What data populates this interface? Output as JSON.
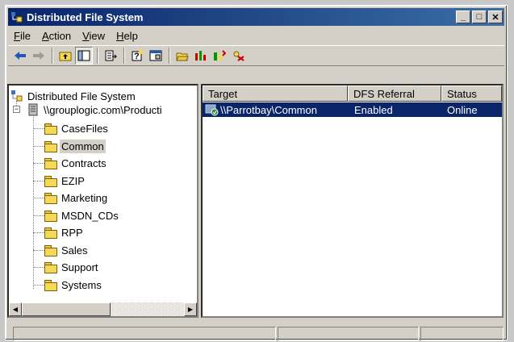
{
  "window": {
    "title": "Distributed File System"
  },
  "titlebar_buttons": {
    "minimize": "_",
    "maximize": "□",
    "close": "✕"
  },
  "menu": [
    {
      "key": "F",
      "rest": "ile"
    },
    {
      "key": "A",
      "rest": "ction"
    },
    {
      "key": "V",
      "rest": "iew"
    },
    {
      "key": "H",
      "rest": "elp"
    }
  ],
  "toolbar_icons": [
    "back-arrow-icon",
    "forward-arrow-icon",
    "up-folder-icon",
    "show-tree-icon",
    "export-list-icon",
    "help-icon",
    "properties-icon",
    "open-folder-icon",
    "chart-icon",
    "add-replica-icon",
    "delete-icon"
  ],
  "tree": {
    "root": "Distributed File System",
    "server": "\\\\grouplogic.com\\Producti",
    "folders": [
      "CaseFiles",
      "Common",
      "Contracts",
      "EZIP",
      "Marketing",
      "MSDN_CDs",
      "RPP",
      "Sales",
      "Support",
      "Systems"
    ],
    "selected": "Common"
  },
  "table": {
    "columns": [
      "Target",
      "DFS Referral",
      "Status"
    ],
    "rows": [
      {
        "target": "\\\\Parrotbay\\Common",
        "referral": "Enabled",
        "status": "Online"
      }
    ]
  },
  "colors": {
    "title_gradient_start": "#0a246a",
    "title_gradient_end": "#3a6ea5",
    "selection": "#0a246a",
    "chrome": "#d4d0c8"
  }
}
